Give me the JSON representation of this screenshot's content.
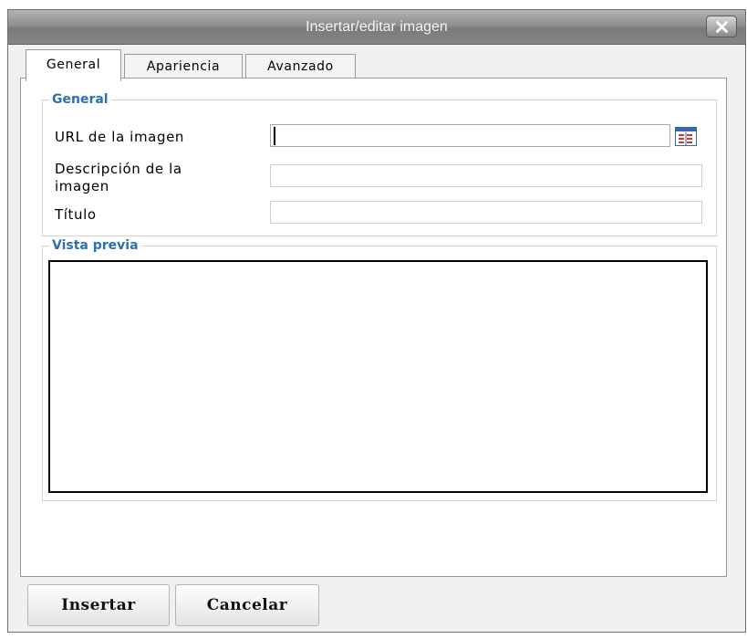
{
  "dialog": {
    "title": "Insertar/editar imagen"
  },
  "tabs": [
    {
      "label": "General",
      "active": true
    },
    {
      "label": "Apariencia",
      "active": false
    },
    {
      "label": "Avanzado",
      "active": false
    }
  ],
  "general_section": {
    "legend": "General",
    "fields": {
      "url": {
        "label": "URL de la imagen",
        "value": ""
      },
      "description": {
        "label_line1": "Descripción de la",
        "label_line2": "imagen",
        "value": ""
      },
      "title": {
        "label": "Título",
        "value": ""
      }
    },
    "browse_icon": "file-browser-icon"
  },
  "preview_section": {
    "legend": "Vista previa"
  },
  "buttons": {
    "insert": "Insertar",
    "cancel": "Cancelar"
  }
}
